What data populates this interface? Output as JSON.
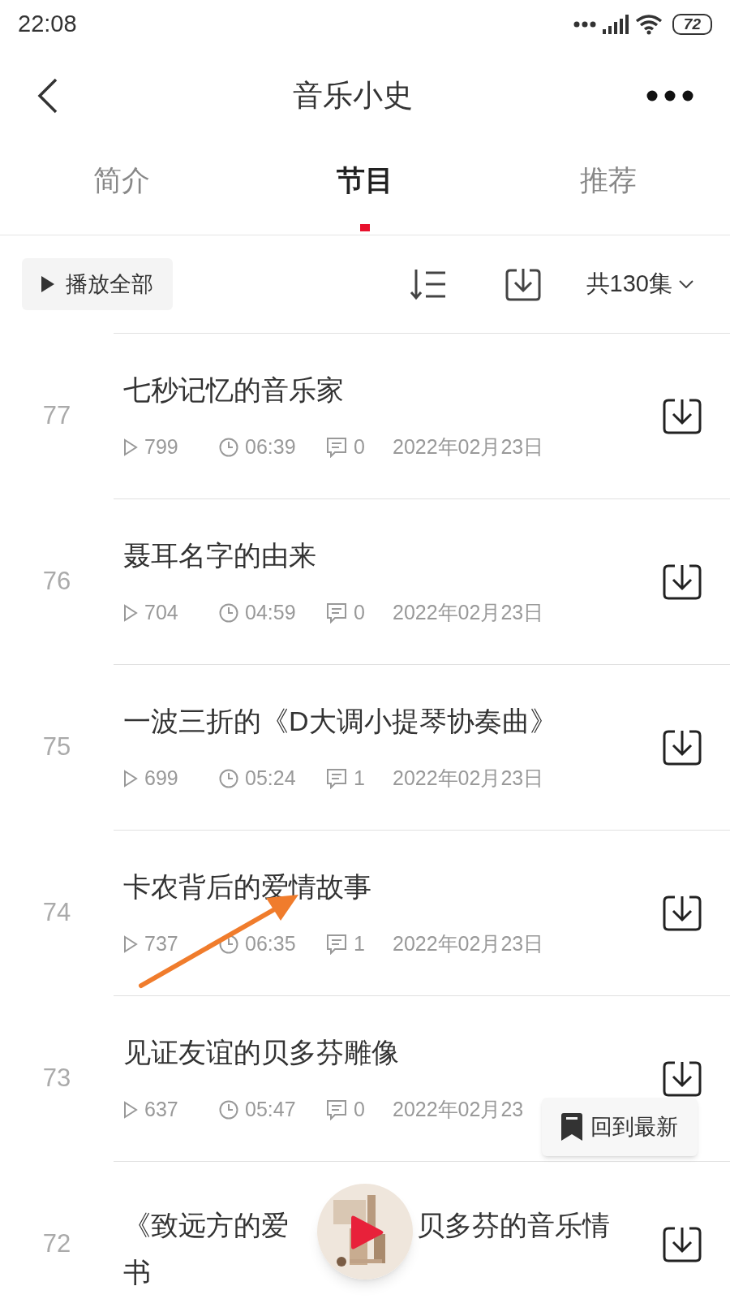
{
  "status_bar": {
    "time": "22:08",
    "battery": "72"
  },
  "header": {
    "title": "音乐小史"
  },
  "tabs": [
    {
      "label": "简介",
      "selected": false
    },
    {
      "label": "节目",
      "selected": true
    },
    {
      "label": "推荐",
      "selected": false
    }
  ],
  "toolbar": {
    "play_all": "播放全部",
    "count": "共130集"
  },
  "episodes": [
    {
      "number": "77",
      "title": "七秒记忆的音乐家",
      "plays": "799",
      "duration": "06:39",
      "comments": "0",
      "date": "2022年02月23日"
    },
    {
      "number": "76",
      "title": "聂耳名字的由来",
      "plays": "704",
      "duration": "04:59",
      "comments": "0",
      "date": "2022年02月23日"
    },
    {
      "number": "75",
      "title": "一波三折的《D大调小提琴协奏曲》",
      "plays": "699",
      "duration": "05:24",
      "comments": "1",
      "date": "2022年02月23日"
    },
    {
      "number": "74",
      "title": "卡农背后的爱情故事",
      "plays": "737",
      "duration": "06:35",
      "comments": "1",
      "date": "2022年02月23日"
    },
    {
      "number": "73",
      "title": "见证友谊的贝多芬雕像",
      "plays": "637",
      "duration": "05:47",
      "comments": "0",
      "date": "2022年02月23"
    },
    {
      "number": "72",
      "title_parts": [
        "《致远方的爱",
        "贝多芬的音乐情",
        "书"
      ]
    }
  ],
  "back_to_latest": "回到最新",
  "annotations": [
    {
      "kind": "arrow"
    }
  ]
}
